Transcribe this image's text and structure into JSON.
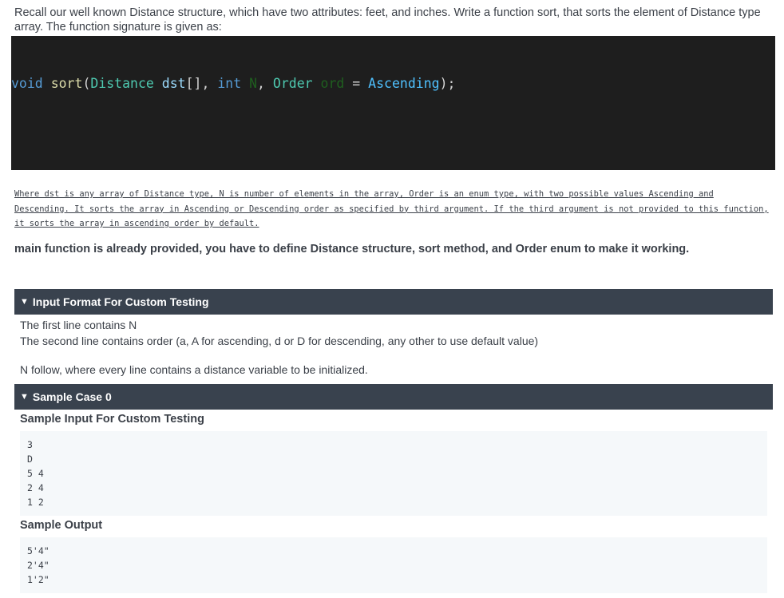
{
  "intro": "Recall our well known Distance structure, which have two attributes: feet, and inches. Write a function sort, that sorts the element of Distance type array. The function signature is given as:",
  "code": {
    "kw_void": "void",
    "fn_name": "sort",
    "paren_open": "(",
    "type_distance": "Distance",
    "param_dst": "dst",
    "brackets_comma": "[], ",
    "kw_int": "int",
    "param_n": "N",
    "comma": ", ",
    "type_order": "Order",
    "param_ord": "ord",
    "equals": " = ",
    "value_ascending": "Ascending",
    "close": ");"
  },
  "description": "Where dst is any array of Distance type, N is number of elements in the array, Order is an enum type, with two possible values Ascending and Descending. It sorts the array in Ascending or Descending order as specified by third argument. If the third argument is not provided to this function, it sorts the array in ascending order by default.",
  "note": "main function is already provided, you have to define Distance structure, sort method, and Order enum to make it working.",
  "input_format": {
    "title": "Input Format For Custom Testing",
    "line1": "The first line contains N",
    "line2": "The second line contains order (a, A for ascending, d or D for descending, any other to use default value)",
    "line3": "N follow, where every line contains a distance variable to be initialized."
  },
  "sample_case": {
    "title": "Sample Case 0",
    "input_heading": "Sample Input For Custom Testing",
    "input": "3\nD\n5 4\n2 4\n1 2",
    "output_heading": "Sample Output",
    "output": "5'4\"\n2'4\"\n1'2\""
  },
  "colors": {
    "code_bg": "#1e1e1e",
    "section_bar": "#39424e",
    "pre_bg": "#f5f8fa"
  }
}
